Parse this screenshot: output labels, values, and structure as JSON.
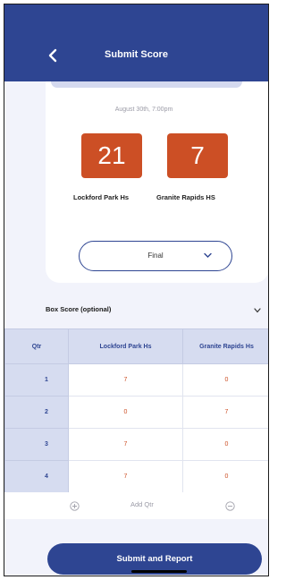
{
  "header": {
    "title": "Submit Score",
    "back_icon": "chevron-left-icon"
  },
  "score_card": {
    "date": "August 30th, 7:00pm",
    "home_team": "Lockford Park Hs",
    "away_team": "Granite Rapids HS",
    "home_score": "21",
    "away_score": "7",
    "status": "Final",
    "accent_color": "#cc4f25"
  },
  "box_score": {
    "title": "Box Score (optional)",
    "columns": [
      "Qtr",
      "Lockford Park Hs",
      "Granite Rapids Hs"
    ],
    "rows": [
      {
        "qtr": "1",
        "home": "7",
        "away": "0"
      },
      {
        "qtr": "2",
        "home": "0",
        "away": "7"
      },
      {
        "qtr": "3",
        "home": "7",
        "away": "0"
      },
      {
        "qtr": "4",
        "home": "7",
        "away": "0"
      }
    ],
    "add_qtr_label": "Add Qtr"
  },
  "submit": {
    "label": "Submit and Report"
  },
  "colors": {
    "brand": "#2e4592",
    "accent": "#cc4f25",
    "table_header": "#d6dcf0"
  }
}
